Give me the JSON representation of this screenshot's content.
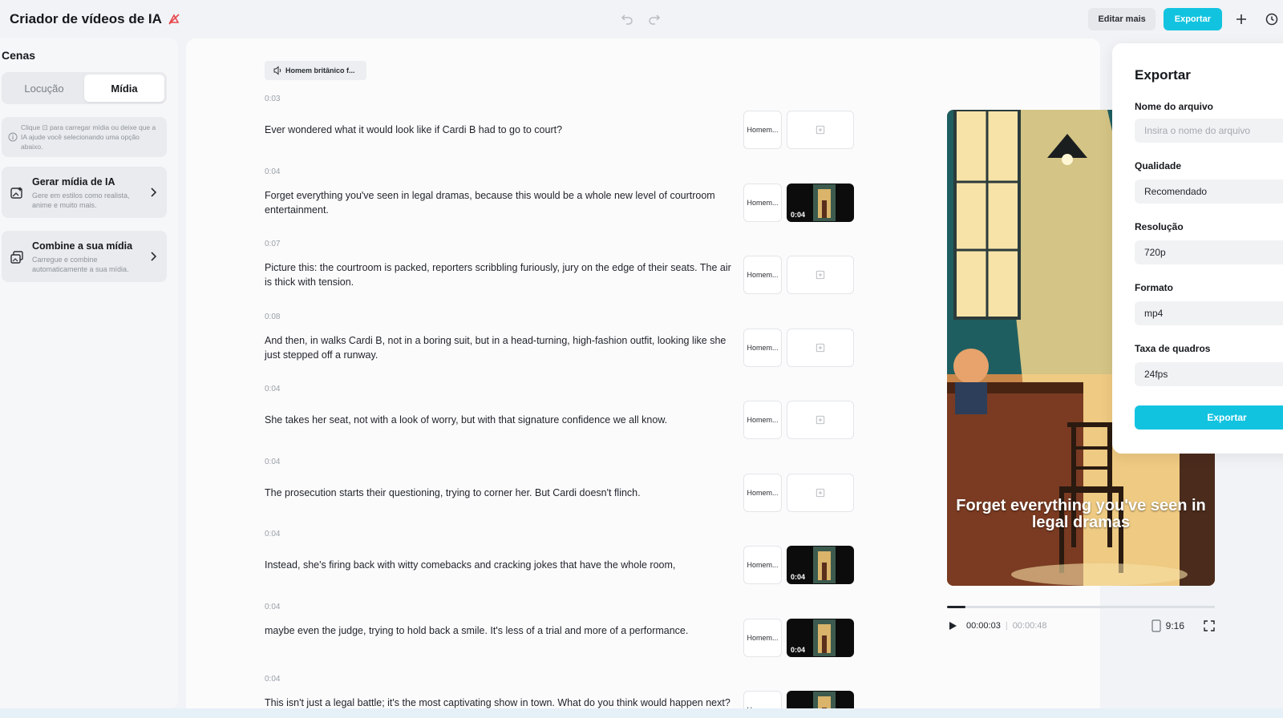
{
  "app": {
    "title": "Criador de vídeos de IA",
    "icons": {
      "badge": "sparkle-strike-icon",
      "undo": "undo-icon",
      "redo": "redo-icon",
      "add": "plus-icon",
      "history": "clock-icon"
    },
    "edit_more_label": "Editar mais",
    "export_label": "Exportar",
    "accent_color": "#12c3e0"
  },
  "sidebar": {
    "title": "Cenas",
    "tabs": [
      {
        "label": "Locução",
        "active": false
      },
      {
        "label": "Mídia",
        "active": true
      }
    ],
    "hint": "Clique ⊡ para carregar mídia ou deixe que a IA ajude você selecionando uma opção abaixo.",
    "cards": [
      {
        "title": "Gerar mídia de IA",
        "desc": "Gere em estilos como realista, anime e muito mais.",
        "icon": "ai-image-icon"
      },
      {
        "title": "Combine a sua mídia",
        "desc": "Carregue e combine automaticamente a sua mídia.",
        "icon": "media-stack-icon"
      }
    ]
  },
  "script": {
    "voice_chip": "Homem britânico f...",
    "voice_short": "Homem...",
    "scenes": [
      {
        "time": "0:03",
        "text": "Ever wondered what it would look like if Cardi B had to go to court?",
        "has_media": false,
        "media_duration": ""
      },
      {
        "time": "0:04",
        "text": "Forget everything you've seen in legal dramas, because this would be a whole new level of courtroom entertainment.",
        "has_media": true,
        "media_duration": "0:04"
      },
      {
        "time": "0:07",
        "text": "Picture this: the courtroom is packed, reporters scribbling furiously, jury on the edge of their seats. The air is thick with tension.",
        "has_media": false,
        "media_duration": ""
      },
      {
        "time": "0:08",
        "text": "And then, in walks Cardi B, not in a boring suit, but in a head-turning, high-fashion outfit, looking like she just stepped off a runway.",
        "has_media": false,
        "media_duration": ""
      },
      {
        "time": "0:04",
        "text": "She takes her seat, not with a look of worry, but with that signature confidence we all know.",
        "has_media": false,
        "media_duration": ""
      },
      {
        "time": "0:04",
        "text": "The prosecution starts their questioning, trying to corner her. But Cardi doesn't flinch.",
        "has_media": false,
        "media_duration": ""
      },
      {
        "time": "0:04",
        "text": "Instead, she's firing back with witty comebacks and cracking jokes that have the whole room,",
        "has_media": true,
        "media_duration": "0:04"
      },
      {
        "time": "0:04",
        "text": "maybe even the judge, trying to hold back a smile. It's less of a trial and more of a performance.",
        "has_media": true,
        "media_duration": "0:04"
      },
      {
        "time": "0:04",
        "text": "This isn't just a legal battle; it's the most captivating show in town. What do you think would happen next?",
        "has_media": true,
        "media_duration": ""
      }
    ]
  },
  "preview": {
    "caption": "Forget everything you've seen in legal dramas",
    "current_time": "00:00:03",
    "total_time": "00:00:48",
    "progress": 0.07,
    "aspect_ratio": "9:16"
  },
  "export_panel": {
    "title": "Exportar",
    "filename_label": "Nome do arquivo",
    "filename_placeholder": "Insira o nome do arquivo",
    "quality_label": "Qualidade",
    "quality_value": "Recomendado",
    "resolution_label": "Resolução",
    "resolution_value": "720p",
    "format_label": "Formato",
    "format_value": "mp4",
    "framerate_label": "Taxa de quadros",
    "framerate_value": "24fps",
    "button_label": "Exportar"
  }
}
